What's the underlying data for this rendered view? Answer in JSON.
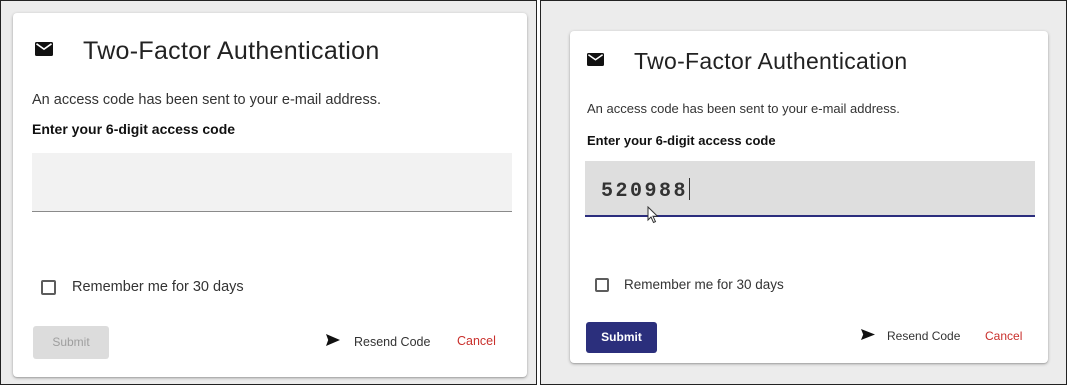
{
  "colors": {
    "accent": "#2b2f7c",
    "cancel": "#c9302c",
    "disabled_button": "#dcdcdc",
    "page_background": "#ececec"
  },
  "icons": {
    "mail": "mail-icon",
    "send": "send-icon",
    "pointer": "mouse-pointer-icon"
  },
  "left": {
    "title": "Two-Factor Authentication",
    "description": "An access code has been sent to your e-mail address.",
    "prompt": "Enter your 6-digit access code",
    "code_value": "",
    "remember_label": "Remember me for 30 days",
    "remember_checked": false,
    "submit_label": "Submit",
    "submit_enabled": false,
    "resend_label": "Resend Code",
    "cancel_label": "Cancel"
  },
  "right": {
    "title": "Two-Factor Authentication",
    "description": "An access code has been sent to your e-mail address.",
    "prompt": "Enter your 6-digit access code",
    "code_value": "520988",
    "remember_label": "Remember me for 30 days",
    "remember_checked": false,
    "submit_label": "Submit",
    "submit_enabled": true,
    "resend_label": "Resend Code",
    "cancel_label": "Cancel"
  }
}
